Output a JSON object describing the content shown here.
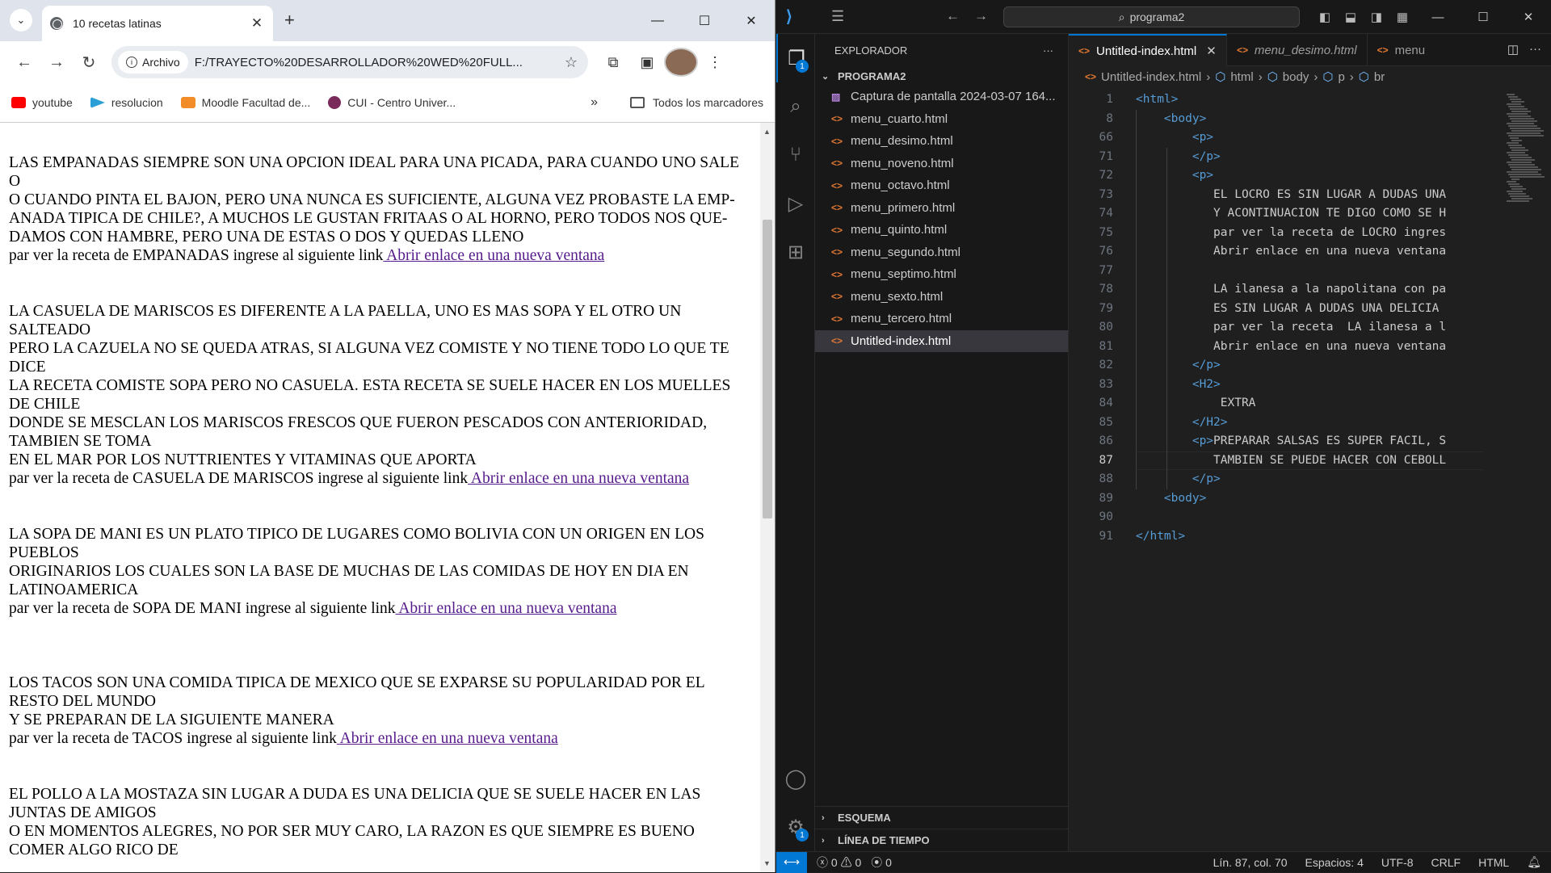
{
  "browser": {
    "tab_title": "10 recetas latinas",
    "new_tab": "+",
    "site_chip": "Archivo",
    "url": "F:/TRAYECTO%20DESARROLLADOR%20WED%20FULL...",
    "bookmarks": [
      {
        "label": "youtube",
        "color": "#ff0000"
      },
      {
        "label": "resolucion",
        "color": "#2a9fd6"
      },
      {
        "label": "Moodle Facultad de...",
        "color": "#f28c28"
      },
      {
        "label": "CUI - Centro Univer...",
        "color": "#7a2a5a"
      }
    ],
    "all_bookmarks": "Todos los marcadores",
    "paragraphs": [
      {
        "lines": [
          "LAS EMPANADAS SIEMPRE SON UNA OPCION IDEAL PARA UNA PICADA, PARA CUANDO UNO SALE O",
          "O CUANDO PINTA EL BAJON, PERO UNA NUNCA ES SUFICIENTE, ALGUNA VEZ PROBASTE LA EMP-",
          "ANADA TIPICA DE CHILE?, A MUCHOS LE GUSTAN FRITAAS O AL HORNO, PERO TODOS NOS QUE-",
          "DAMOS CON HAMBRE, PERO UNA DE ESTAS O DOS Y QUEDAS LLENO"
        ],
        "link_prefix": "par ver la receta de EMPANADAS ingrese al siguiente link",
        "link": " Abrir enlace en una nueva ventana"
      },
      {
        "lines": [
          "LA CASUELA DE MARISCOS ES DIFERENTE A LA PAELLA, UNO ES MAS SOPA Y EL OTRO UN SALTEADO",
          "PERO LA CAZUELA NO SE QUEDA ATRAS, SI ALGUNA VEZ COMISTE Y NO TIENE TODO LO QUE TE DICE",
          "LA RECETA COMISTE SOPA PERO NO CASUELA. ESTA RECETA SE SUELE HACER EN LOS MUELLES DE CHILE",
          "DONDE SE MESCLAN LOS MARISCOS FRESCOS QUE FUERON PESCADOS CON ANTERIORIDAD, TAMBIEN SE TOMA",
          "EN EL MAR POR LOS NUTTRIENTES Y VITAMINAS QUE APORTA"
        ],
        "link_prefix": "par ver la receta de CASUELA DE MARISCOS ingrese al siguiente link",
        "link": " Abrir enlace en una nueva ventana"
      },
      {
        "lines": [
          "LA SOPA DE MANI ES UN PLATO TIPICO DE LUGARES COMO BOLIVIA CON UN ORIGEN EN LOS PUEBLOS",
          "ORIGINARIOS LOS CUALES SON LA BASE DE MUCHAS DE LAS COMIDAS DE HOY EN DIA EN LATINOAMERICA"
        ],
        "link_prefix": "par ver la receta de SOPA DE MANI ingrese al siguiente link",
        "link": " Abrir enlace en una nueva ventana"
      },
      {
        "lines": [
          "LOS TACOS SON UNA COMIDA TIPICA DE MEXICO QUE SE EXPARSE SU POPULARIDAD POR EL RESTO DEL MUNDO",
          "Y SE PREPARAN DE LA SIGUIENTE MANERA"
        ],
        "link_prefix": "par ver la receta de TACOS ingrese al siguiente link",
        "link": " Abrir enlace en una nueva ventana"
      },
      {
        "lines": [
          "EL POLLO A LA MOSTAZA SIN LUGAR A DUDA ES UNA DELICIA QUE SE SUELE HACER EN LAS JUNTAS DE AMIGOS",
          "O EN MOMENTOS ALEGRES, NO POR SER MUY CARO, LA RAZON ES QUE SIEMPRE ES BUENO COMER ALGO RICO DE"
        ],
        "link_prefix": "",
        "link": ""
      }
    ]
  },
  "vscode": {
    "search": "programa2",
    "explorer_title": "EXPLORADOR",
    "explorer_more": "···",
    "folder": "PROGRAMA2",
    "files": [
      "Captura de pantalla 2024-03-07 164...",
      "menu_cuarto.html",
      "menu_desimo.html",
      "menu_noveno.html",
      "menu_octavo.html",
      "menu_primero.html",
      "menu_quinto.html",
      "menu_segundo.html",
      "menu_septimo.html",
      "menu_sexto.html",
      "menu_tercero.html",
      "Untitled-index.html"
    ],
    "outline": "ESQUEMA",
    "timeline": "LÍNEA DE TIEMPO",
    "tabs": [
      "Untitled-index.html",
      "menu_desimo.html",
      "menu"
    ],
    "breadcrumbs": [
      "Untitled-index.html",
      "html",
      "body",
      "p",
      "br"
    ],
    "code_lines": [
      {
        "n": "1",
        "t": "<html>"
      },
      {
        "n": "8",
        "t": "    <body>"
      },
      {
        "n": "66",
        "t": "        <p>"
      },
      {
        "n": "71",
        "t": "        </p>"
      },
      {
        "n": "72",
        "t": "        <p>"
      },
      {
        "n": "73",
        "t": "           EL LOCRO ES SIN LUGAR A DUDAS UNA"
      },
      {
        "n": "74",
        "t": "           Y ACONTINUACION TE DIGO COMO SE H"
      },
      {
        "n": "75",
        "t": "           par ver la receta de LOCRO ingres"
      },
      {
        "n": "76",
        "t": "           Abrir enlace en una nueva ventana"
      },
      {
        "n": "77",
        "t": ""
      },
      {
        "n": "78",
        "t": "           LA ilanesa a la napolitana con pa"
      },
      {
        "n": "79",
        "t": "           ES SIN LUGAR A DUDAS UNA DELICIA "
      },
      {
        "n": "80",
        "t": "           par ver la receta  LA ilanesa a l"
      },
      {
        "n": "81",
        "t": "           Abrir enlace en una nueva ventana"
      },
      {
        "n": "82",
        "t": "        </p>"
      },
      {
        "n": "83",
        "t": "        <H2>"
      },
      {
        "n": "84",
        "t": "            EXTRA"
      },
      {
        "n": "85",
        "t": "        </H2>"
      },
      {
        "n": "86",
        "t": "        <p>PREPARAR SALSAS ES SUPER FACIL, S"
      },
      {
        "n": "87",
        "t": "           TAMBIEN SE PUEDE HACER CON CEBOLL"
      },
      {
        "n": "88",
        "t": "        </p>"
      },
      {
        "n": "89",
        "t": "    <body>"
      },
      {
        "n": "90",
        "t": ""
      },
      {
        "n": "91",
        "t": "</html>"
      }
    ],
    "status": {
      "errors": "0",
      "warnings": "0",
      "ports": "0",
      "position": "Lín. 87, col. 70",
      "spaces": "Espacios: 4",
      "encoding": "UTF-8",
      "eol": "CRLF",
      "language": "HTML"
    },
    "accent": "#0078d4"
  }
}
